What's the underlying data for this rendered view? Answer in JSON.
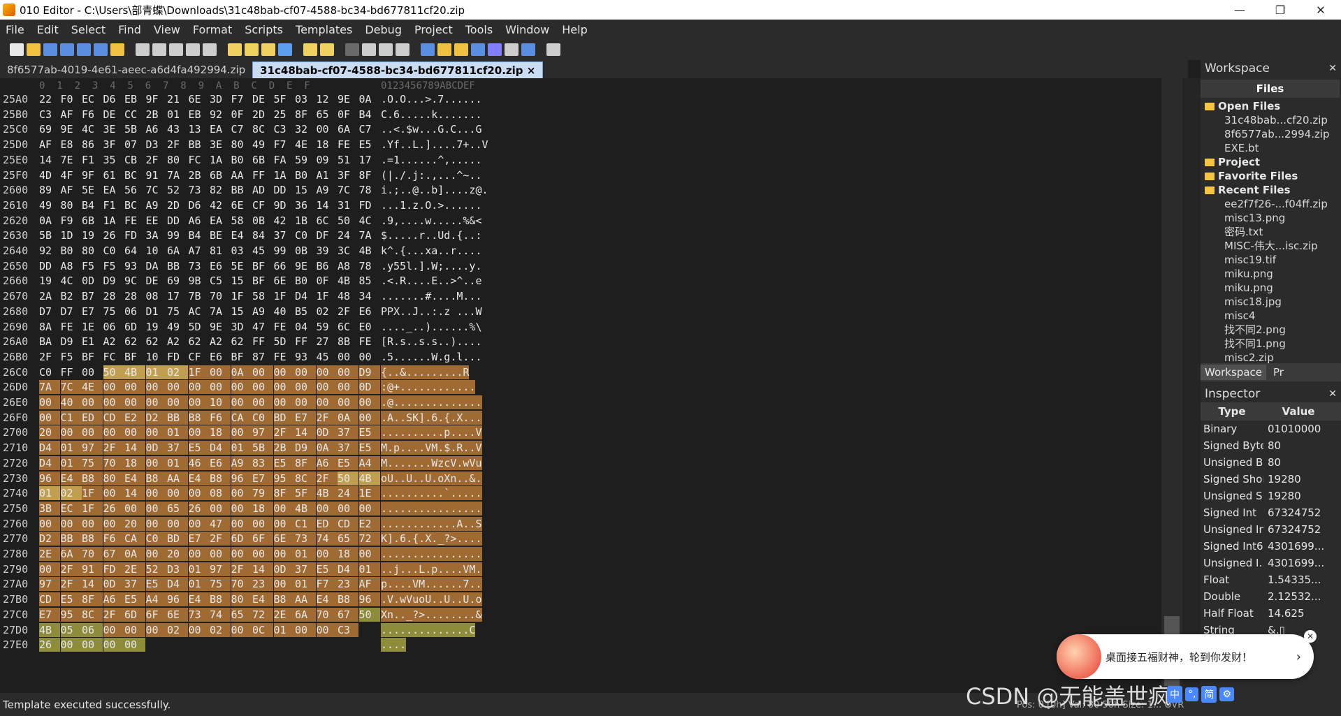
{
  "window": {
    "title": "010 Editor - C:\\Users\\部青蝶\\Downloads\\31c48bab-cf07-4588-bc34-bd677811cf20.zip",
    "minimize": "—",
    "restore": "❐",
    "close": "✕"
  },
  "menu": [
    "File",
    "Edit",
    "Select",
    "Find",
    "View",
    "Format",
    "Scripts",
    "Templates",
    "Debug",
    "Project",
    "Tools",
    "Window",
    "Help"
  ],
  "tabs": [
    {
      "label": "8f6577ab-4019-4e61-aeec-a6d4fa492994.zip"
    },
    {
      "label": "31c48bab-cf07-4588-bc34-bd677811cf20.zip ×"
    }
  ],
  "editor": {
    "ruler_hex": "0  1  2  3  4  5  6  7  8  9  A  B  C  D  E  F",
    "ruler_ascii": "0123456789ABCDEF",
    "rows": [
      {
        "a": "25A0",
        "h": [
          "22",
          "F0",
          "EC",
          "D6",
          "EB",
          "9F",
          "21",
          "6E",
          "3D",
          "F7",
          "DE",
          "5F",
          "03",
          "12",
          "9E",
          "0A"
        ],
        "s": ".O.O...>.7......"
      },
      {
        "a": "25B0",
        "h": [
          "C3",
          "AF",
          "F6",
          "DE",
          "CC",
          "2B",
          "01",
          "EB",
          "92",
          "0F",
          "2D",
          "25",
          "8F",
          "65",
          "0F",
          "B4"
        ],
        "s": "C.6.....k......."
      },
      {
        "a": "25C0",
        "h": [
          "69",
          "9E",
          "4C",
          "3E",
          "5B",
          "A6",
          "43",
          "13",
          "EA",
          "C7",
          "8C",
          "C3",
          "32",
          "00",
          "6A",
          "C7"
        ],
        "s": "..<.$w...G.C...G"
      },
      {
        "a": "25D0",
        "h": [
          "AF",
          "E8",
          "86",
          "3F",
          "07",
          "D3",
          "2F",
          "BB",
          "3E",
          "80",
          "49",
          "F7",
          "4E",
          "18",
          "FE",
          "E5"
        ],
        "s": ".Yf..L.]....7+..V"
      },
      {
        "a": "25E0",
        "h": [
          "14",
          "7E",
          "F1",
          "35",
          "CB",
          "2F",
          "80",
          "FC",
          "1A",
          "B0",
          "6B",
          "FA",
          "59",
          "09",
          "51",
          "17"
        ],
        "s": ".=1......^,....."
      },
      {
        "a": "25F0",
        "h": [
          "4D",
          "4F",
          "9F",
          "61",
          "BC",
          "91",
          "7A",
          "2B",
          "6B",
          "AA",
          "FF",
          "1A",
          "B0",
          "A1",
          "3F",
          "8F"
        ],
        "s": "(|./.j:.,...^~.."
      },
      {
        "a": "2600",
        "h": [
          "89",
          "AF",
          "5E",
          "EA",
          "56",
          "7C",
          "52",
          "73",
          "82",
          "BB",
          "AD",
          "DD",
          "15",
          "A9",
          "7C",
          "78"
        ],
        "s": "i.;..@..b]....z@."
      },
      {
        "a": "2610",
        "h": [
          "49",
          "80",
          "B4",
          "F1",
          "BC",
          "A9",
          "2D",
          "D6",
          "42",
          "6E",
          "CF",
          "9D",
          "36",
          "14",
          "31",
          "FD"
        ],
        "s": "...1.z.O.>......"
      },
      {
        "a": "2620",
        "h": [
          "0A",
          "F9",
          "6B",
          "1A",
          "FE",
          "EE",
          "DD",
          "A6",
          "EA",
          "58",
          "0B",
          "42",
          "1B",
          "6C",
          "50",
          "4C"
        ],
        "s": ".9,....w.....%&<"
      },
      {
        "a": "2630",
        "h": [
          "5B",
          "1D",
          "19",
          "26",
          "FD",
          "3A",
          "99",
          "B4",
          "BE",
          "E4",
          "84",
          "37",
          "C0",
          "DF",
          "24",
          "7A"
        ],
        "s": "$.....r..Ud.{..:"
      },
      {
        "a": "2640",
        "h": [
          "92",
          "B0",
          "80",
          "C0",
          "64",
          "10",
          "6A",
          "A7",
          "81",
          "03",
          "45",
          "99",
          "0B",
          "39",
          "3C",
          "4B"
        ],
        "s": "k^.{...xa..r...."
      },
      {
        "a": "2650",
        "h": [
          "DD",
          "A8",
          "F5",
          "F5",
          "93",
          "DA",
          "BB",
          "73",
          "E6",
          "5E",
          "BF",
          "66",
          "9E",
          "B6",
          "A8",
          "78"
        ],
        "s": ".y55l.].W;....y."
      },
      {
        "a": "2660",
        "h": [
          "19",
          "4C",
          "0D",
          "D9",
          "9C",
          "DE",
          "69",
          "9B",
          "C5",
          "15",
          "BF",
          "6E",
          "B0",
          "0F",
          "4B",
          "85"
        ],
        "s": ".<.R....E..>^..e"
      },
      {
        "a": "2670",
        "h": [
          "2A",
          "B2",
          "B7",
          "28",
          "28",
          "08",
          "17",
          "7B",
          "70",
          "1F",
          "58",
          "1F",
          "D4",
          "1F",
          "48",
          "34"
        ],
        "s": ".......#....M..."
      },
      {
        "a": "2680",
        "h": [
          "D7",
          "D7",
          "E7",
          "75",
          "06",
          "D1",
          "75",
          "AC",
          "7A",
          "15",
          "A9",
          "40",
          "B5",
          "02",
          "2F",
          "E6"
        ],
        "s": "PPX..J..:.z ...W"
      },
      {
        "a": "2690",
        "h": [
          "8A",
          "FE",
          "1E",
          "06",
          "6D",
          "19",
          "49",
          "5D",
          "9E",
          "3D",
          "47",
          "FE",
          "04",
          "59",
          "6C",
          "E0"
        ],
        "s": "...._..)......%\\"
      },
      {
        "a": "26A0",
        "h": [
          "BA",
          "D9",
          "E1",
          "A2",
          "62",
          "62",
          "A2",
          "62",
          "A2",
          "62",
          "FF",
          "5D",
          "FF",
          "27",
          "8B",
          "FE"
        ],
        "s": "[R.s..s.s..)...."
      },
      {
        "a": "26B0",
        "h": [
          "2F",
          "F5",
          "BF",
          "FC",
          "BF",
          "10",
          "FD",
          "CF",
          "E6",
          "BF",
          "87",
          "FE",
          "93",
          "45",
          "00",
          "00"
        ],
        "s": ".5......W.g.l..."
      },
      {
        "a": "26C0",
        "h": [
          "C0",
          "FF",
          "00",
          "50",
          "4B",
          "01",
          "02",
          "1F",
          "00",
          "0A",
          "00",
          "00",
          "00",
          "00",
          "00",
          "D9"
        ],
        "s": "{..&.........R",
        "hl": 3
      },
      {
        "a": "26D0",
        "h": [
          "7A",
          "7C",
          "4E",
          "00",
          "00",
          "00",
          "00",
          "00",
          "00",
          "00",
          "00",
          "00",
          "00",
          "00",
          "00",
          "0D"
        ],
        "s": ":@+............",
        "hl": 0
      },
      {
        "a": "26E0",
        "h": [
          "00",
          "40",
          "00",
          "00",
          "00",
          "00",
          "00",
          "00",
          "10",
          "00",
          "00",
          "00",
          "00",
          "00",
          "00",
          "00"
        ],
        "s": ".@..............",
        "hl": 0
      },
      {
        "a": "26F0",
        "h": [
          "00",
          "C1",
          "ED",
          "CD",
          "E2",
          "D2",
          "BB",
          "B8",
          "F6",
          "CA",
          "C0",
          "BD",
          "E7",
          "2F",
          "0A",
          "00"
        ],
        "s": ".A..SK].6.{.X...",
        "hl": 0
      },
      {
        "a": "2700",
        "h": [
          "20",
          "00",
          "00",
          "00",
          "00",
          "00",
          "01",
          "00",
          "18",
          "00",
          "97",
          "2F",
          "14",
          "0D",
          "37",
          "E5"
        ],
        "s": "..........p....V",
        "hl": 0
      },
      {
        "a": "2710",
        "h": [
          "D4",
          "01",
          "97",
          "2F",
          "14",
          "0D",
          "37",
          "E5",
          "D4",
          "01",
          "5B",
          "2B",
          "D9",
          "0A",
          "37",
          "E5"
        ],
        "s": "M.p....VM.$.R..V",
        "hl": 0
      },
      {
        "a": "2720",
        "h": [
          "D4",
          "01",
          "75",
          "70",
          "18",
          "00",
          "01",
          "46",
          "E6",
          "A9",
          "83",
          "E5",
          "8F",
          "A6",
          "E5",
          "A4"
        ],
        "s": "M.......WzcV.wVu",
        "hl": 0
      },
      {
        "a": "2730",
        "h": [
          "96",
          "E4",
          "B8",
          "80",
          "E4",
          "B8",
          "AA",
          "E4",
          "B8",
          "96",
          "E7",
          "95",
          "8C",
          "2F",
          "50",
          "4B"
        ],
        "s": "oU..U..U.oXn..&.",
        "hl": 0
      },
      {
        "a": "2740",
        "h": [
          "01",
          "02",
          "1F",
          "00",
          "14",
          "00",
          "00",
          "00",
          "08",
          "00",
          "79",
          "8F",
          "5F",
          "4B",
          "24",
          "1E"
        ],
        "s": "..........`.....",
        "hl": 0
      },
      {
        "a": "2750",
        "h": [
          "3B",
          "EC",
          "1F",
          "26",
          "00",
          "00",
          "65",
          "26",
          "00",
          "00",
          "18",
          "00",
          "4B",
          "00",
          "00",
          "00"
        ],
        "s": "................",
        "hl": 0
      },
      {
        "a": "2760",
        "h": [
          "00",
          "00",
          "00",
          "00",
          "20",
          "00",
          "00",
          "00",
          "47",
          "00",
          "00",
          "00",
          "C1",
          "ED",
          "CD",
          "E2"
        ],
        "s": "............A..S",
        "hl": 0
      },
      {
        "a": "2770",
        "h": [
          "D2",
          "BB",
          "B8",
          "F6",
          "CA",
          "C0",
          "BD",
          "E7",
          "2F",
          "6D",
          "6F",
          "6E",
          "73",
          "74",
          "65",
          "72"
        ],
        "s": "K].6.{.X._?>....",
        "hl": 0
      },
      {
        "a": "2780",
        "h": [
          "2E",
          "6A",
          "70",
          "67",
          "0A",
          "00",
          "20",
          "00",
          "00",
          "00",
          "00",
          "00",
          "01",
          "00",
          "18",
          "00"
        ],
        "s": "................",
        "hl": 0
      },
      {
        "a": "2790",
        "h": [
          "00",
          "2F",
          "91",
          "FD",
          "2E",
          "52",
          "D3",
          "01",
          "97",
          "2F",
          "14",
          "0D",
          "37",
          "E5",
          "D4",
          "01"
        ],
        "s": "..j...L.p....VM.",
        "hl": 0
      },
      {
        "a": "27A0",
        "h": [
          "97",
          "2F",
          "14",
          "0D",
          "37",
          "E5",
          "D4",
          "01",
          "75",
          "70",
          "23",
          "00",
          "01",
          "F7",
          "23",
          "AF"
        ],
        "s": "p....VM......7..",
        "hl": 0
      },
      {
        "a": "27B0",
        "h": [
          "CD",
          "E5",
          "8F",
          "A6",
          "E5",
          "A4",
          "96",
          "E4",
          "B8",
          "80",
          "E4",
          "B8",
          "AA",
          "E4",
          "B8",
          "96"
        ],
        "s": ".V.wVuoU..U..U.o",
        "hl": 0
      },
      {
        "a": "27C0",
        "h": [
          "E7",
          "95",
          "8C",
          "2F",
          "6D",
          "6F",
          "6E",
          "73",
          "74",
          "65",
          "72",
          "2E",
          "6A",
          "70",
          "67",
          "50"
        ],
        "s": "Xn.._?>........&",
        "hl": 0
      },
      {
        "a": "27D0",
        "h": [
          "4B",
          "05",
          "06",
          "00",
          "00",
          "00",
          "02",
          "00",
          "02",
          "00",
          "0C",
          "01",
          "00",
          "00",
          "C3"
        ],
        "s": "..............C",
        "hl": 1
      },
      {
        "a": "27E0",
        "h": [
          "26",
          "00",
          "00",
          "00",
          "00"
        ],
        "s": "....",
        "hl": 2
      }
    ]
  },
  "workspace": {
    "title": "Workspace",
    "files_header": "Files",
    "tree": [
      {
        "type": "folder",
        "label": "Open Files"
      },
      {
        "type": "file",
        "label": "31c48bab...cf20.zip"
      },
      {
        "type": "file",
        "label": "8f6577ab...2994.zip"
      },
      {
        "type": "file",
        "label": "EXE.bt"
      },
      {
        "type": "folder",
        "label": "Project"
      },
      {
        "type": "folder",
        "label": "Favorite Files"
      },
      {
        "type": "folder",
        "label": "Recent Files"
      },
      {
        "type": "file",
        "label": "ee2f7f26-...f04ff.zip"
      },
      {
        "type": "file",
        "label": "misc13.png"
      },
      {
        "type": "file",
        "label": "密码.txt"
      },
      {
        "type": "file",
        "label": "MISC-伟大...isc.zip"
      },
      {
        "type": "file",
        "label": "misc19.tif"
      },
      {
        "type": "file",
        "label": "miku.png"
      },
      {
        "type": "file",
        "label": "miku.png"
      },
      {
        "type": "file",
        "label": "misc18.jpg"
      },
      {
        "type": "file",
        "label": "misc4"
      },
      {
        "type": "file",
        "label": "找不同2.png"
      },
      {
        "type": "file",
        "label": "找不同1.png"
      },
      {
        "type": "file",
        "label": "misc2.zip"
      }
    ],
    "tab_active": "Workspace",
    "tab_other": "Pr"
  },
  "inspector": {
    "title": "Inspector",
    "col_type": "Type",
    "col_value": "Value",
    "rows": [
      {
        "k": "Binary",
        "v": "01010000"
      },
      {
        "k": "Signed Byte",
        "v": "80"
      },
      {
        "k": "Unsigned B...",
        "v": "80"
      },
      {
        "k": "Signed Short",
        "v": "19280"
      },
      {
        "k": "Unsigned S...",
        "v": "19280"
      },
      {
        "k": "Signed Int",
        "v": "67324752"
      },
      {
        "k": "Unsigned Int",
        "v": "67324752"
      },
      {
        "k": "Signed Int64",
        "v": "4301699..."
      },
      {
        "k": "Unsigned I...",
        "v": "4301699..."
      },
      {
        "k": "Float",
        "v": "1.54335..."
      },
      {
        "k": "Double",
        "v": "2.12532..."
      },
      {
        "k": "Half Float",
        "v": "14.625"
      },
      {
        "k": "String",
        "v": "&.▯"
      }
    ]
  },
  "status": {
    "message": "Template executed successfully.",
    "position": "Pos: 0 [0h]  Val: 80 50h  Size: 1... OVR"
  },
  "popup": {
    "text": "桌面接五福财神，轮到你发财！",
    "chevron": "›",
    "close": "✕"
  },
  "watermark": "CSDN @无能盖世疯",
  "ime": [
    "中",
    "°,",
    "简",
    "⚙"
  ]
}
